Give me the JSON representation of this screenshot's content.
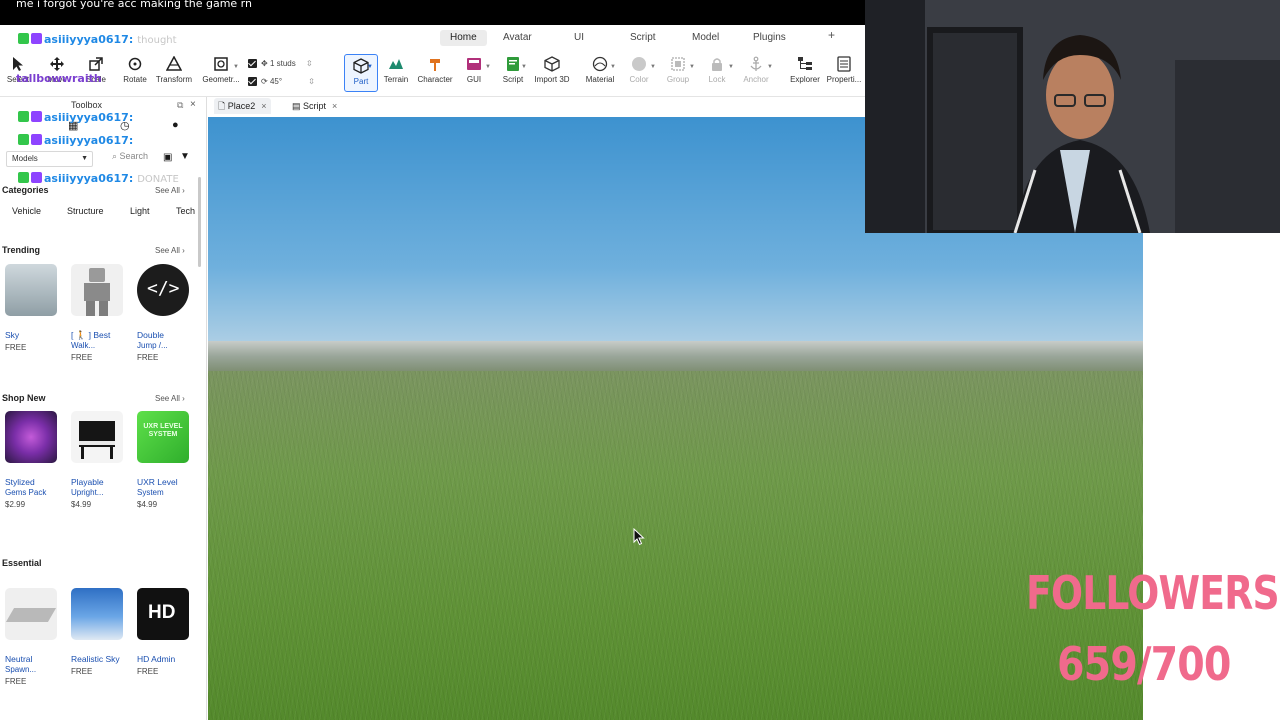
{
  "chat_header": "me i forgot you're acc making the game rn",
  "chat_messages": [
    {
      "user": "asiiiyyya0617:",
      "ghost": "thought"
    },
    {
      "user": "tallbowwraith",
      "ghost": ""
    },
    {
      "user": "asiiiyyya0617:",
      "ghost": ""
    },
    {
      "user": "asiiiyyya0617:",
      "ghost": ""
    },
    {
      "user": "asiiiyyya0617:",
      "ghost": "DONATE"
    }
  ],
  "menu": {
    "tabs": [
      "Home",
      "Avatar",
      "UI",
      "Script",
      "Model",
      "Plugins"
    ],
    "active": "Home",
    "plus": "+"
  },
  "ribbon": {
    "tools": [
      {
        "label": "Select",
        "icon": "cursor-icon"
      },
      {
        "label": "Move",
        "icon": "move-icon"
      },
      {
        "label": "Scale",
        "icon": "scale-icon"
      },
      {
        "label": "Rotate",
        "icon": "rotate-icon"
      },
      {
        "label": "Transform",
        "icon": "transform-icon"
      },
      {
        "label": "Geometr...",
        "icon": "geometry-icon"
      }
    ],
    "snap_move": "1 studs",
    "snap_rotate": "45°",
    "insert": [
      {
        "label": "Part",
        "icon": "part-cube-icon"
      },
      {
        "label": "Terrain",
        "icon": "terrain-icon"
      },
      {
        "label": "Character",
        "icon": "character-icon"
      },
      {
        "label": "GUI",
        "icon": "gui-icon"
      },
      {
        "label": "Script",
        "icon": "script-icon"
      },
      {
        "label": "Import 3D",
        "icon": "import-3d-icon"
      },
      {
        "label": "Material",
        "icon": "material-icon"
      },
      {
        "label": "Color",
        "icon": "color-icon"
      },
      {
        "label": "Group",
        "icon": "group-icon"
      },
      {
        "label": "Lock",
        "icon": "lock-icon"
      },
      {
        "label": "Anchor",
        "icon": "anchor-icon"
      },
      {
        "label": "Explorer",
        "icon": "explorer-icon"
      },
      {
        "label": "Properti...",
        "icon": "properties-icon"
      }
    ]
  },
  "doc_tabs": [
    {
      "label": "Place2",
      "close": "×"
    },
    {
      "label": "Script",
      "close": "×"
    }
  ],
  "toolbox": {
    "title": "Toolbox",
    "category_select": "Models",
    "search_placeholder": "Search",
    "categories_heading": "Categories",
    "see_all": "See All",
    "chips": [
      "Vehicle",
      "Structure",
      "Light",
      "Tech"
    ],
    "sections": [
      {
        "title": "Trending",
        "items": [
          {
            "name": "Sky",
            "name2": "",
            "price": "FREE"
          },
          {
            "name": "[ 🚶 ] Best",
            "name2": "Walk...",
            "price": "FREE"
          },
          {
            "name": "Double",
            "name2": "Jump /...",
            "price": "FREE"
          }
        ]
      },
      {
        "title": "Shop New",
        "items": [
          {
            "name": "Stylized",
            "name2": "Gems Pack",
            "price": "$2.99"
          },
          {
            "name": "Playable",
            "name2": "Upright...",
            "price": "$4.99"
          },
          {
            "name": "UXR Level",
            "name2": "System",
            "price": "$4.99"
          }
        ]
      },
      {
        "title": "Essential",
        "items": [
          {
            "name": "Neutral",
            "name2": "Spawn...",
            "price": "FREE"
          },
          {
            "name": "Realistic Sky",
            "name2": "",
            "price": "FREE"
          },
          {
            "name": "HD Admin",
            "name2": "",
            "price": "FREE"
          }
        ]
      }
    ],
    "uxr_thumb_text": "UXR LEVEL SYSTEM",
    "hd_thumb_text": "HD"
  },
  "followers": {
    "label": "FOLLOWERS:",
    "count": "659/700"
  }
}
